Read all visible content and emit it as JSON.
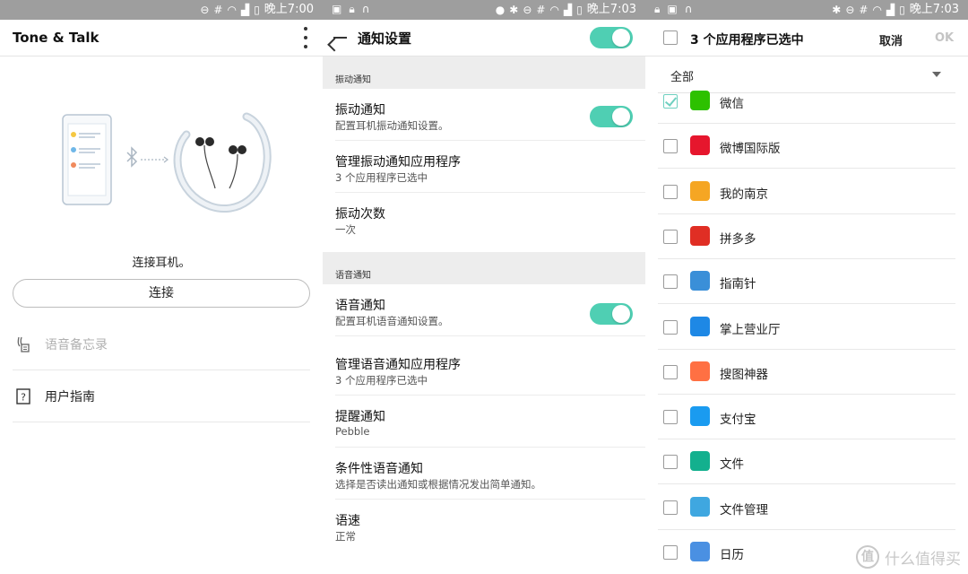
{
  "status_bar": {
    "p1": {
      "time": "晚上7:00",
      "left_icons": [],
      "right_icons": [
        "dnd-icon",
        "hash-icon",
        "wifi-icon",
        "signal-icon",
        "battery-icon"
      ]
    },
    "p2": {
      "time": "晚上7:03",
      "left_icons": [
        "image-icon",
        "lock-icon",
        "headset-icon"
      ],
      "right_icons": [
        "location-icon",
        "bluetooth-icon",
        "dnd-icon",
        "hash-icon",
        "wifi-icon",
        "signal-icon",
        "battery-icon"
      ]
    },
    "p3": {
      "time": "晚上7:03",
      "left_icons": [
        "lock-icon",
        "image-icon",
        "headset-icon"
      ],
      "right_icons": [
        "bluetooth-icon",
        "dnd-icon",
        "hash-icon",
        "wifi-icon",
        "signal-icon",
        "battery-icon"
      ]
    }
  },
  "home": {
    "title": "Tone & Talk",
    "connect_prompt": "连接耳机。",
    "connect_button": "连接",
    "menu": [
      {
        "label": "语音备忘录",
        "icon": "voice-memo-icon",
        "enabled": false
      },
      {
        "label": "用户指南",
        "icon": "help-guide-icon",
        "enabled": true
      }
    ]
  },
  "notifications": {
    "title": "通知设置",
    "master_toggle_on": true,
    "sections": [
      {
        "header": "振动通知",
        "items": [
          {
            "title": "振动通知",
            "subtitle": "配置耳机振动通知设置。",
            "toggle": true
          },
          {
            "title": "管理振动通知应用程序",
            "subtitle": "3 个应用程序已选中"
          },
          {
            "title": "振动次数",
            "subtitle": "一次"
          }
        ]
      },
      {
        "header": "语音通知",
        "items": [
          {
            "title": "语音通知",
            "subtitle": "配置耳机语音通知设置。",
            "toggle": true
          },
          {
            "title": "管理语音通知应用程序",
            "subtitle": "3 个应用程序已选中"
          },
          {
            "title": "提醒通知",
            "subtitle": "Pebble"
          },
          {
            "title": "条件性语音通知",
            "subtitle": "选择是否读出通知或根据情况发出简单通知。"
          },
          {
            "title": "语速",
            "subtitle": "正常"
          }
        ]
      }
    ]
  },
  "app_select": {
    "title": "3 个应用程序已选中",
    "cancel": "取消",
    "ok": "OK",
    "filter": "全部",
    "apps": [
      {
        "name": "微信",
        "checked": true,
        "color": "#2dc100"
      },
      {
        "name": "微博国际版",
        "checked": false,
        "color": "#e6162d"
      },
      {
        "name": "我的南京",
        "checked": false,
        "color": "#f5a623"
      },
      {
        "name": "拼多多",
        "checked": false,
        "color": "#e02e24"
      },
      {
        "name": "指南针",
        "checked": false,
        "color": "#3a8fd8"
      },
      {
        "name": "掌上营业厅",
        "checked": false,
        "color": "#1e88e5"
      },
      {
        "name": "搜图神器",
        "checked": false,
        "color": "#ff7043"
      },
      {
        "name": "支付宝",
        "checked": false,
        "color": "#1a9bf0"
      },
      {
        "name": "文件",
        "checked": false,
        "color": "#13b08e"
      },
      {
        "name": "文件管理",
        "checked": false,
        "color": "#3fa7e0"
      },
      {
        "name": "日历",
        "checked": false,
        "color": "#4a90e2"
      }
    ]
  },
  "watermark": {
    "badge": "值",
    "text": "什么值得买"
  },
  "colors": {
    "accent": "#4fcfb3",
    "status_bar": "#9e9e9e",
    "section_bg": "#ededed"
  }
}
